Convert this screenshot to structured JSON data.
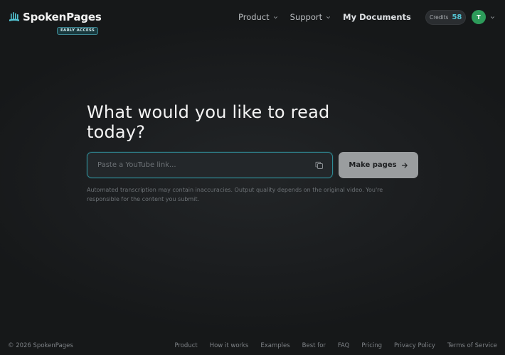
{
  "brand": {
    "name": "SpokenPages",
    "badge": "EARLY ACCESS",
    "icon": "waveform-book-icon",
    "accent_color": "#53c4d3"
  },
  "nav": {
    "items": [
      {
        "label": "Product",
        "has_dropdown": true
      },
      {
        "label": "Support",
        "has_dropdown": true
      },
      {
        "label": "My Documents",
        "has_dropdown": false
      }
    ]
  },
  "account": {
    "credits_label": "Credits",
    "credits_value": "58",
    "avatar_initial": "T",
    "avatar_color": "#2d9b5a"
  },
  "main": {
    "headline": "What would you like to read today?",
    "input_placeholder": "Paste a YouTube link...",
    "input_value": "",
    "paste_icon": "clipboard-icon",
    "submit_label": "Make pages",
    "disclaimer": "Automated transcription may contain inaccuracies. Output quality depends on the original video. You're responsible for the content you submit."
  },
  "footer": {
    "copyright": "© 2026 SpokenPages",
    "links": [
      "Product",
      "How it works",
      "Examples",
      "Best for",
      "FAQ",
      "Pricing",
      "Privacy Policy",
      "Terms of Service"
    ]
  }
}
